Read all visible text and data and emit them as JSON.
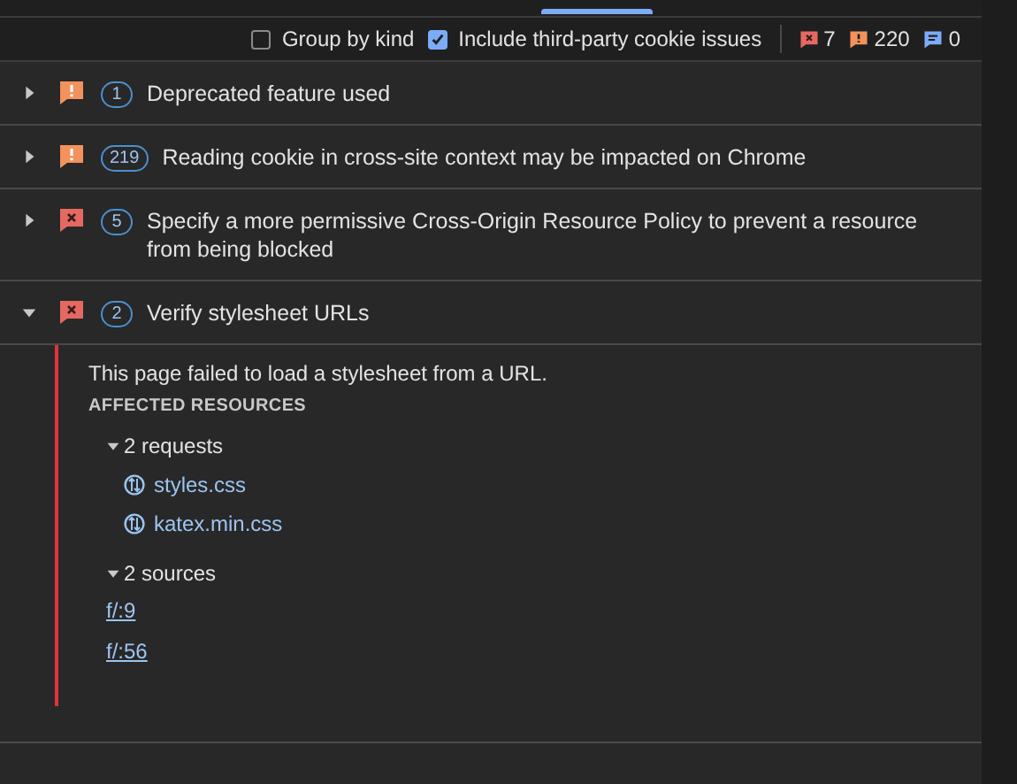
{
  "toolbar": {
    "options": [
      {
        "label": "Group by kind",
        "checked": false
      },
      {
        "label": "Include third-party cookie issues",
        "checked": true
      }
    ],
    "counts": [
      {
        "kind": "error",
        "count": "7"
      },
      {
        "kind": "warning",
        "count": "220"
      },
      {
        "kind": "info",
        "count": "0"
      }
    ]
  },
  "issues": [
    {
      "kind": "warning",
      "count": "1",
      "title": "Deprecated feature used",
      "expanded": false
    },
    {
      "kind": "warning",
      "count": "219",
      "title": "Reading cookie in cross-site context may be impacted on Chrome",
      "expanded": false
    },
    {
      "kind": "error",
      "count": "5",
      "title": "Specify a more permissive Cross-Origin Resource Policy to prevent a resource from being blocked",
      "expanded": false
    },
    {
      "kind": "error",
      "count": "2",
      "title": "Verify stylesheet URLs",
      "expanded": true,
      "details": {
        "description": "This page failed to load a stylesheet from a URL.",
        "section_title": "AFFECTED RESOURCES",
        "groups": [
          {
            "label": "2 requests",
            "kind": "request",
            "expanded": true,
            "items": [
              "styles.css",
              "katex.min.css"
            ]
          },
          {
            "label": "2 sources",
            "kind": "source",
            "expanded": true,
            "items": [
              "f/:9",
              "f/:56"
            ]
          }
        ]
      }
    }
  ]
}
